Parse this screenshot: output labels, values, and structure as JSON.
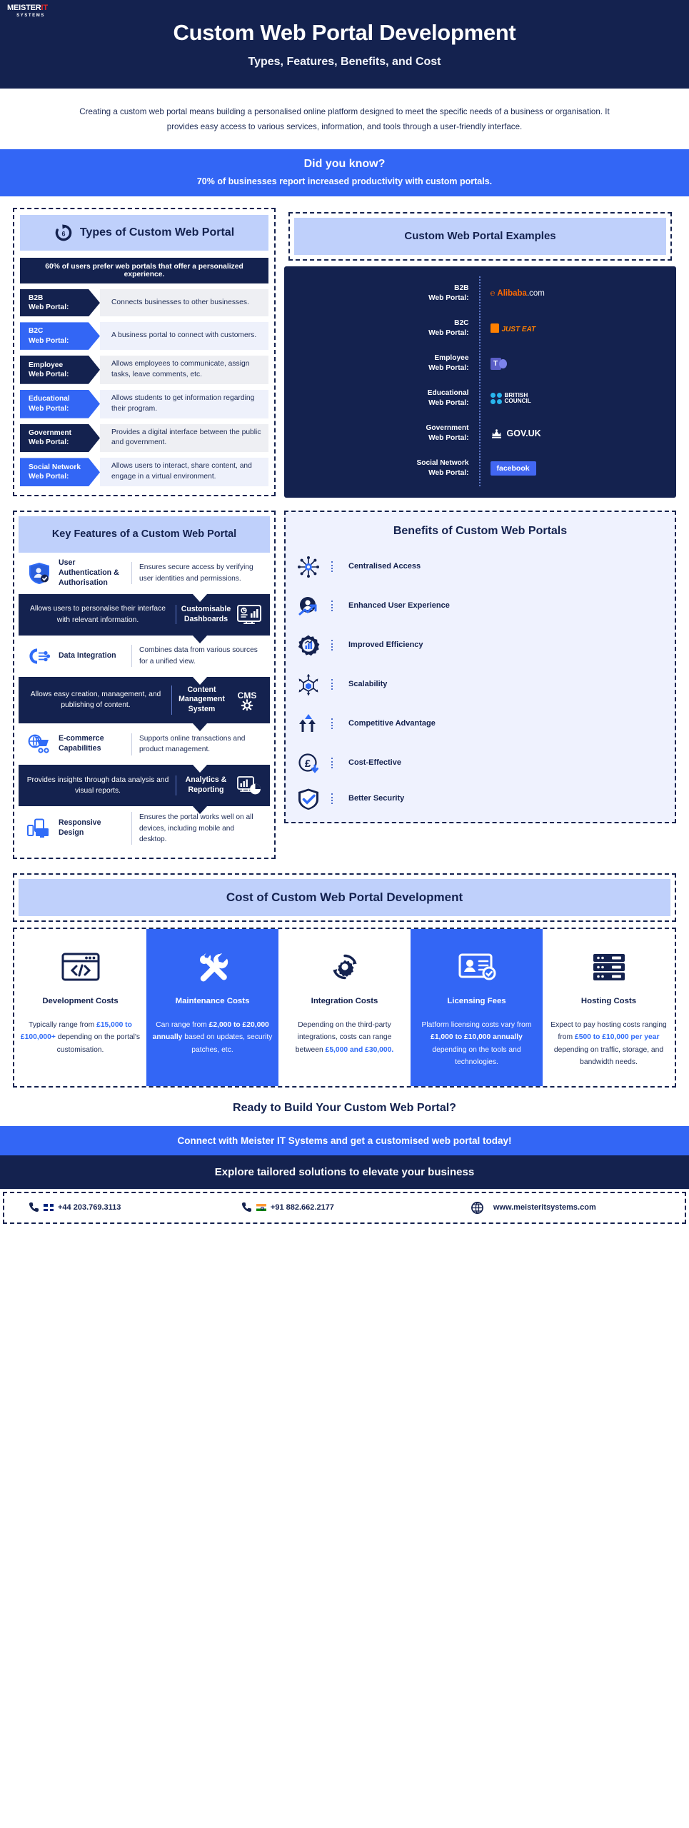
{
  "brand": {
    "logo_main": "MEISTER",
    "logo_accent": "IT",
    "logo_sub": "SYSTEMS"
  },
  "header": {
    "title": "Custom Web Portal Development",
    "subtitle": "Types, Features, Benefits, and Cost"
  },
  "intro": {
    "text": "Creating a custom web portal means building a personalised online platform designed to meet the specific needs of a business or organisation. It provides easy access to various services, information, and tools through a user-friendly interface."
  },
  "did_you_know": {
    "title": "Did you know?",
    "stat": "70% of businesses report increased productivity with custom portals."
  },
  "types": {
    "heading": "Types of Custom Web Portal",
    "icon": "refresh-6-icon",
    "stat": "60% of users prefer web portals that offer a personalized experience.",
    "items": [
      {
        "name": "B2B\nWeb Portal:",
        "label_line1": "B2B",
        "label_line2": "Web Portal:",
        "desc": "Connects businesses to other businesses."
      },
      {
        "label_line1": "B2C",
        "label_line2": "Web Portal:",
        "desc": "A business portal to connect with customers."
      },
      {
        "label_line1": "Employee",
        "label_line2": "Web Portal:",
        "desc": "Allows employees to communicate, assign tasks, leave comments, etc."
      },
      {
        "label_line1": "Educational",
        "label_line2": "Web Portal:",
        "desc": "Allows students to get information regarding their program."
      },
      {
        "label_line1": "Government",
        "label_line2": "Web Portal:",
        "desc": "Provides a digital interface between the public and government."
      },
      {
        "label_line1": "Social Network",
        "label_line2": "Web Portal:",
        "desc": "Allows users to interact, share content, and engage in a virtual environment."
      }
    ]
  },
  "examples": {
    "heading": "Custom Web Portal Examples",
    "items": [
      {
        "label_line1": "B2B",
        "label_line2": "Web Portal:",
        "brand": "Alibaba.com",
        "brand_mark": "alibaba-logo",
        "brand_color": "#ff6a00"
      },
      {
        "label_line1": "B2C",
        "label_line2": "Web Portal:",
        "brand": "JUST EAT",
        "brand_mark": "just-eat-logo",
        "brand_color": "#ff8000"
      },
      {
        "label_line1": "Employee",
        "label_line2": "Web Portal:",
        "brand": "Microsoft Teams",
        "brand_mark": "microsoft-teams-logo",
        "brand_color": "#5b5fc7"
      },
      {
        "label_line1": "Educational",
        "label_line2": "Web Portal:",
        "brand": "BRITISH COUNCIL",
        "brand_mark": "british-council-logo",
        "brand_color": "#29b6ee"
      },
      {
        "label_line1": "Government",
        "label_line2": "Web Portal:",
        "brand": "GOV.UK",
        "brand_mark": "gov-uk-logo",
        "brand_color": "#ffffff"
      },
      {
        "label_line1": "Social Network",
        "label_line2": "Web Portal:",
        "brand": "facebook",
        "brand_mark": "facebook-logo",
        "brand_color": "#4267f2"
      }
    ]
  },
  "features": {
    "heading": "Key Features of a Custom Web Portal",
    "items": [
      {
        "name": "User Authentication & Authorisation",
        "desc": "Ensures secure access by verifying user identities and permissions.",
        "icon": "shield-user-check-icon",
        "style": "light"
      },
      {
        "name": "Customisable Dashboards",
        "desc": "Allows users to personalise their interface with relevant information.",
        "icon": "dashboard-chart-icon",
        "style": "dark"
      },
      {
        "name": "Data Integration",
        "desc": "Combines data from various sources for a unified view.",
        "icon": "gear-network-icon",
        "style": "light"
      },
      {
        "name": "Content Management System",
        "short": "CMS",
        "desc": "Allows easy creation, management, and publishing of content.",
        "icon": "cms-gear-icon",
        "style": "dark"
      },
      {
        "name": "E-commerce Capabilities",
        "desc": "Supports online transactions and product management.",
        "icon": "globe-cart-icon",
        "style": "light"
      },
      {
        "name": "Analytics & Reporting",
        "desc": "Provides insights through data analysis and visual reports.",
        "icon": "analytics-pie-icon",
        "style": "dark"
      },
      {
        "name": "Responsive Design",
        "desc": "Ensures the portal works well on all devices, including mobile and desktop.",
        "icon": "responsive-devices-icon",
        "style": "light"
      }
    ]
  },
  "benefits": {
    "heading": "Benefits of Custom Web Portals",
    "items": [
      {
        "label": "Centralised Access",
        "icon": "hub-network-icon"
      },
      {
        "label": "Enhanced User Experience",
        "icon": "user-growth-icon"
      },
      {
        "label": "Improved Efficiency",
        "icon": "gear-bars-icon"
      },
      {
        "label": "Scalability",
        "icon": "cube-expand-icon"
      },
      {
        "label": "Competitive Advantage",
        "icon": "arrows-up-icon"
      },
      {
        "label": "Cost-Effective",
        "icon": "pound-down-icon"
      },
      {
        "label": "Better Security",
        "icon": "shield-check-icon"
      }
    ]
  },
  "cost": {
    "heading": "Cost of Custom Web Portal Development",
    "columns": [
      {
        "name": "Development Costs",
        "icon": "code-window-icon",
        "highlight": false,
        "text_parts": [
          {
            "t": "Typically range from ",
            "b": false
          },
          {
            "t": "£15,000 to £100,000+",
            "b": true
          },
          {
            "t": " depending on the portal's customisation.",
            "b": false
          }
        ]
      },
      {
        "name": "Maintenance Costs",
        "icon": "tools-icon",
        "highlight": true,
        "text_parts": [
          {
            "t": "Can range from ",
            "b": false
          },
          {
            "t": "£2,000 to £20,000 annually",
            "b": true
          },
          {
            "t": " based on updates, security patches, etc.",
            "b": false
          }
        ]
      },
      {
        "name": "Integration Costs",
        "icon": "gear-sync-icon",
        "highlight": false,
        "text_parts": [
          {
            "t": "Depending on the third-party integrations, costs can range between ",
            "b": false
          },
          {
            "t": "£5,000 and £30,000.",
            "b": true
          }
        ]
      },
      {
        "name": "Licensing Fees",
        "icon": "license-card-icon",
        "highlight": true,
        "text_parts": [
          {
            "t": "Platform licensing costs vary from ",
            "b": false
          },
          {
            "t": "£1,000 to £10,000 annually",
            "b": true
          },
          {
            "t": " depending on the tools and technologies.",
            "b": false
          }
        ]
      },
      {
        "name": "Hosting Costs",
        "icon": "server-rack-icon",
        "highlight": false,
        "text_parts": [
          {
            "t": "Expect to pay hosting costs ranging from ",
            "b": false
          },
          {
            "t": "£500 to £10,000 per year",
            "b": true
          },
          {
            "t": " depending on traffic, storage, and bandwidth needs.",
            "b": false
          }
        ]
      }
    ]
  },
  "cta": {
    "line1": "Ready to Build Your Custom Web Portal?",
    "line2": "Connect with Meister IT Systems and get a customised web portal today!",
    "line3": "Explore tailored solutions to elevate your business"
  },
  "contact": {
    "phone_uk": "+44 203.769.3113",
    "phone_in": "+91 882.662.2177",
    "website": "www.meisteritsystems.com",
    "icons": {
      "phone": "phone-icon",
      "globe": "globe-icon",
      "flag_uk": "uk-flag-icon",
      "flag_in": "india-flag-icon"
    }
  },
  "colors": {
    "navy": "#14224f",
    "blue": "#3366f5",
    "lilac": "#bfd0fb",
    "accent": "#2f6bf7"
  }
}
